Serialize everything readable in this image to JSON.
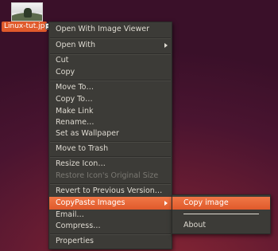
{
  "desktop": {
    "file_label": "Linux-tut.jp"
  },
  "context_menu": {
    "items": [
      {
        "label": "Open With Image Viewer"
      },
      {
        "label": "Open With"
      },
      {
        "label": "Cut"
      },
      {
        "label": "Copy"
      },
      {
        "label": "Move To…"
      },
      {
        "label": "Copy To…"
      },
      {
        "label": "Make Link"
      },
      {
        "label": "Rename…"
      },
      {
        "label": "Set as Wallpaper"
      },
      {
        "label": "Move to Trash"
      },
      {
        "label": "Resize Icon…"
      },
      {
        "label": "Restore Icon's Original Size"
      },
      {
        "label": "Revert to Previous Version…"
      },
      {
        "label": "CopyPaste Images"
      },
      {
        "label": "Email…"
      },
      {
        "label": "Compress…"
      },
      {
        "label": "Properties"
      }
    ]
  },
  "submenu": {
    "items": [
      {
        "label": "Copy image"
      },
      {
        "label": "About"
      }
    ]
  },
  "colors": {
    "highlight": "#e05a2b",
    "menu_bg": "#3c3b37",
    "menu_text": "#dfdbd2",
    "disabled_text": "#7b7973"
  }
}
